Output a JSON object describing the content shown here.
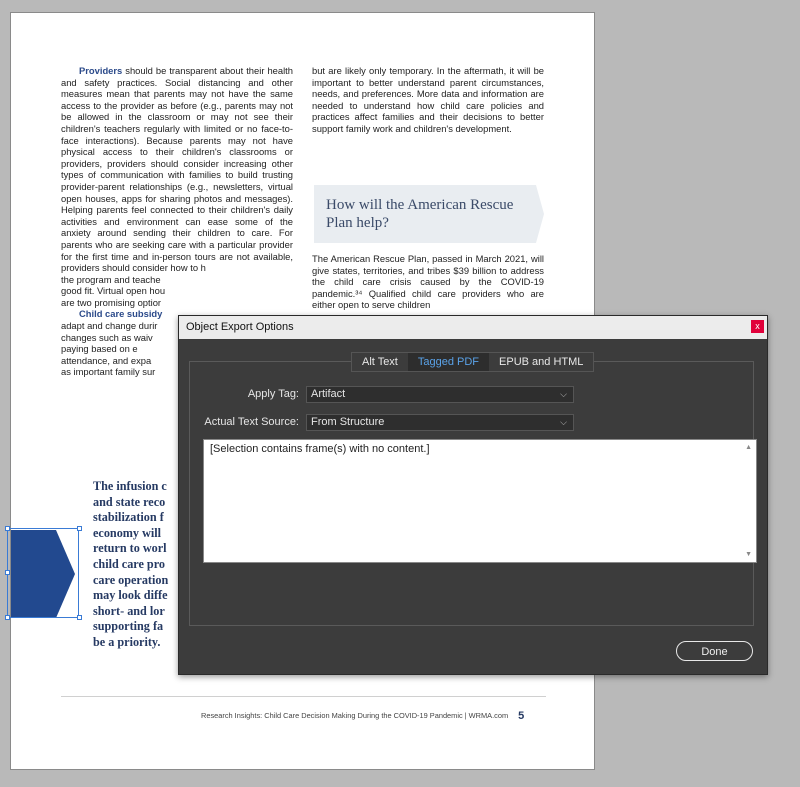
{
  "document": {
    "left_col": [
      {
        "lead": "Providers",
        "text": " should be transparent about their health and safety practices. Social distancing and other measures mean that parents may not have the same access to the provider as before (e.g., parents may not be allowed in the classroom or may not see their children's teachers regularly with limited or no face-to-face interactions). Because parents may not have physical access to their children's classrooms or providers, providers should consider increasing other types of communication with families to build trusting provider-parent relationships (e.g., newsletters, virtual open houses, apps for sharing photos and messages). Helping parents feel connected to their children's daily activities and environment can ease some of the anxiety around sending their children to care. For parents who are seeking care with a particular provider for the first time and in-person tours are not available, providers should consider how to h"
      },
      {
        "lead": "",
        "text": "the program and teache"
      },
      {
        "lead": "",
        "text": "good fit. Virtual open hou"
      },
      {
        "lead": "",
        "text": "are two promising optior"
      },
      {
        "lead": "Child care subsidy",
        "text": ""
      },
      {
        "lead": "",
        "text": "adapt and change durir"
      },
      {
        "lead": "",
        "text": "changes such as waiv"
      },
      {
        "lead": "",
        "text": "paying based on e"
      },
      {
        "lead": "",
        "text": "attendance, and expa"
      },
      {
        "lead": "",
        "text": "as important family sur"
      }
    ],
    "right_col_top": "but are likely only temporary. In the aftermath, it will be important to better understand parent circumstances, needs, and preferences. More data and information are needed to understand how child care policies and practices affect families and their decisions to better support family work and children's development.",
    "callout_title": "How will the American Rescue Plan help?",
    "right_col_bottom": "The American Rescue Plan, passed in March 2021, will give states, territories, and tribes $39 billion to address the child care crisis caused by the COVID-19 pandemic.³⁴ Qualified child care providers who are either open to serve children",
    "quote_lines": [
      "The infusion c",
      "and state reco",
      "stabilization f",
      "economy will",
      "return to worl",
      "child care pro",
      "care operation",
      "may look diffe",
      "short- and lor",
      "supporting fa",
      "be a priority."
    ],
    "footer": "Research Insights: Child Care Decision Making During the COVID-19 Pandemic  |  WRMA.com",
    "page_number": "5",
    "brand_color": "#263a63"
  },
  "dialog": {
    "title": "Object Export Options",
    "close_label": "x",
    "tabs": [
      {
        "label": "Alt Text",
        "active": false
      },
      {
        "label": "Tagged PDF",
        "active": true
      },
      {
        "label": "EPUB and HTML",
        "active": false
      }
    ],
    "apply_tag": {
      "label": "Apply Tag:",
      "value": "Artifact"
    },
    "actual_text_source": {
      "label": "Actual Text Source:",
      "value": "From Structure"
    },
    "textarea_value": "[Selection contains frame(s) with no content.]",
    "done_label": "Done",
    "accent_color": "#5aa2e8",
    "close_color": "#e0003a"
  }
}
